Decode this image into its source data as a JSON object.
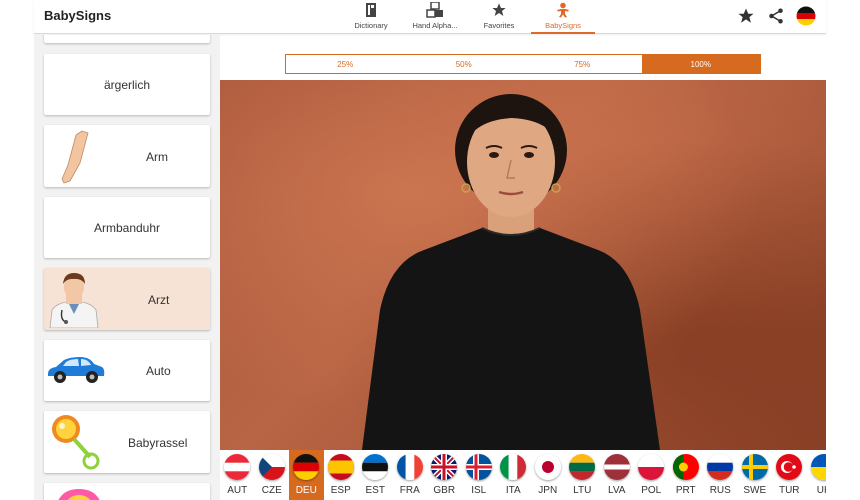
{
  "app": {
    "title": "BabySigns"
  },
  "tabs": [
    {
      "label": "Dictionary",
      "icon": "book-icon"
    },
    {
      "label": "Hand Alpha...",
      "icon": "alphabet-blocks-icon"
    },
    {
      "label": "Favorites",
      "icon": "star-icon"
    },
    {
      "label": "BabySigns",
      "icon": "baby-icon",
      "active": true
    }
  ],
  "actions": {
    "favorite": "star-icon",
    "share": "share-icon",
    "language": "germany-flag-icon"
  },
  "sidebar": {
    "items": [
      {
        "label": "ärgerlich"
      },
      {
        "label": "Arm"
      },
      {
        "label": "Armbanduhr"
      },
      {
        "label": "Arzt",
        "selected": true
      },
      {
        "label": "Auto"
      },
      {
        "label": "Babyrassel"
      }
    ]
  },
  "speeds": {
    "options": [
      "25%",
      "50%",
      "75%",
      "100%"
    ],
    "selected": "100%"
  },
  "languages": {
    "codes": [
      "AUT",
      "CZE",
      "DEU",
      "ESP",
      "EST",
      "FRA",
      "GBR",
      "ISL",
      "ITA",
      "JPN",
      "LTU",
      "LVA",
      "POL",
      "PRT",
      "RUS",
      "SWE",
      "TUR",
      "UKR"
    ],
    "visible_labels": [
      "AUT",
      "CZE",
      "DEU",
      "ESP",
      "EST",
      "FRA",
      "GBR",
      "ISL",
      "ITA",
      "JPN",
      "LTU",
      "LVA",
      "POL",
      "PRT",
      "RUS",
      "SWE",
      "TUR",
      "UK"
    ],
    "selected": "DEU"
  },
  "colors": {
    "accent": "#d66a1e",
    "selected_card": "#f6e3d5",
    "background": "#f2f2f2"
  }
}
